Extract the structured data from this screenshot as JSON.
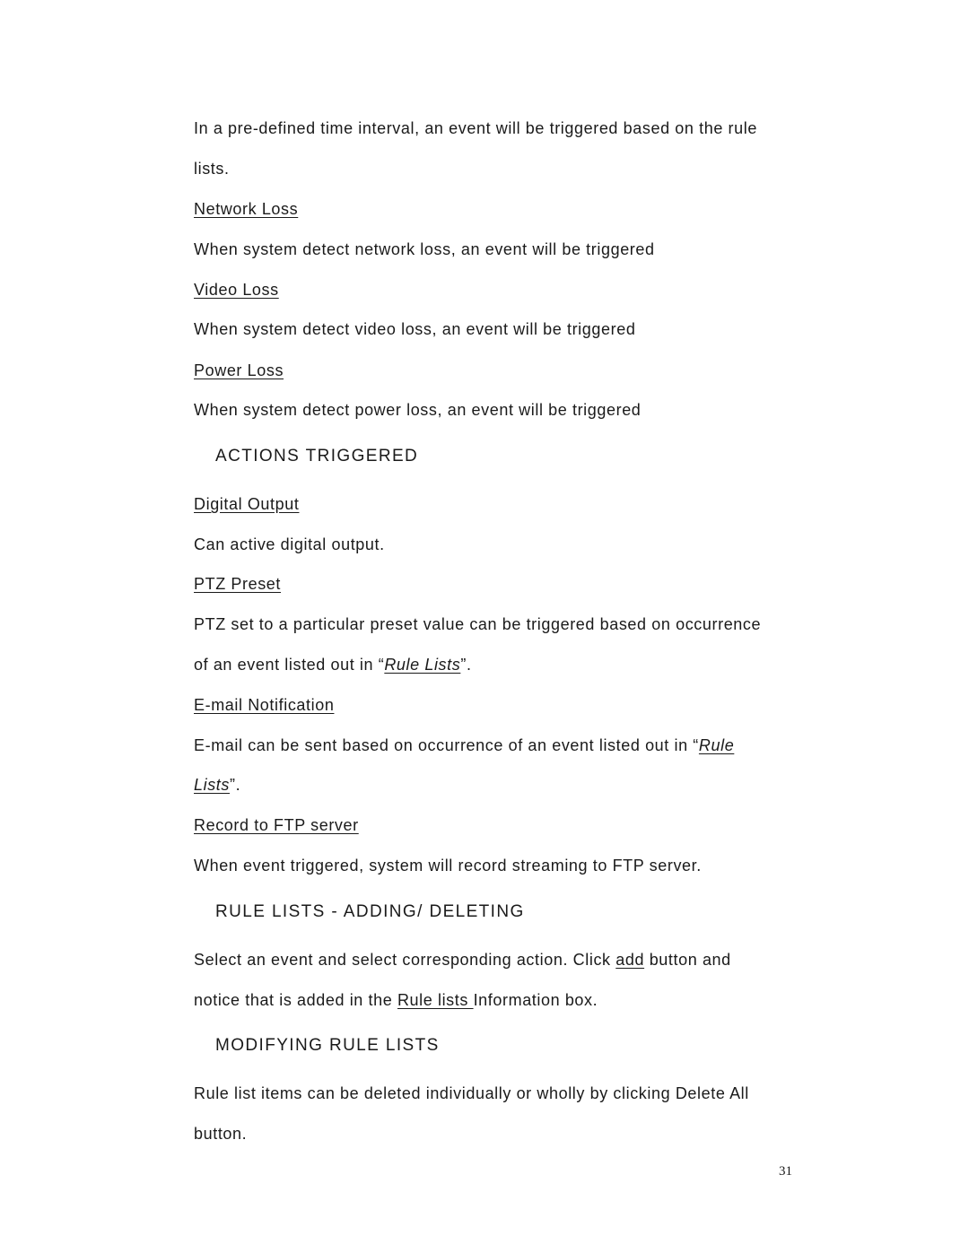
{
  "page": {
    "intro": {
      "line1": "In a pre-defined time interval, an event will be triggered based on the rule",
      "line2": "lists."
    },
    "events": [
      {
        "title": "Network Loss",
        "desc": "When system detect network loss, an event will be triggered"
      },
      {
        "title": "Video Loss",
        "desc": "When system detect video loss, an event will be triggered"
      },
      {
        "title": "Power Loss",
        "desc": "When system detect power loss, an event will be triggered"
      }
    ],
    "actions_heading": "ACTIONS TRIGGERED",
    "actions": {
      "digital_output": {
        "title": "Digital Output",
        "desc": "Can active digital output."
      },
      "ptz_preset": {
        "title": "PTZ Preset",
        "line1": "PTZ set to a particular preset value can be triggered based on occurrence",
        "line2_pre": "of an event listed out in “",
        "line2_link": "Rule Lists",
        "line2_post": "”."
      },
      "email": {
        "title": "E-mail Notification",
        "line1_pre": "E-mail can be sent based on occurrence of an event listed out in “",
        "line1_link": "Rule ",
        "line2_link": "Lists",
        "line2_post": "”."
      },
      "ftp": {
        "title": "Record to FTP server",
        "desc": "When event triggered, system will record streaming to FTP server."
      }
    },
    "rule_lists_heading": "RULE LISTS - ADDING/ DELETING",
    "rule_lists": {
      "line1_pre": "Select an event and select corresponding action. Click ",
      "line1_link": "add",
      "line1_post": " button and",
      "line2_pre": "notice that is added in the ",
      "line2_link": "Rule lists ",
      "line2_post": "Information box."
    },
    "modifying_heading": "MODIFYING RULE LISTS",
    "modifying": {
      "line1": "Rule list items can be deleted individually or wholly by clicking Delete All",
      "line2": "button."
    },
    "page_number": "31"
  }
}
